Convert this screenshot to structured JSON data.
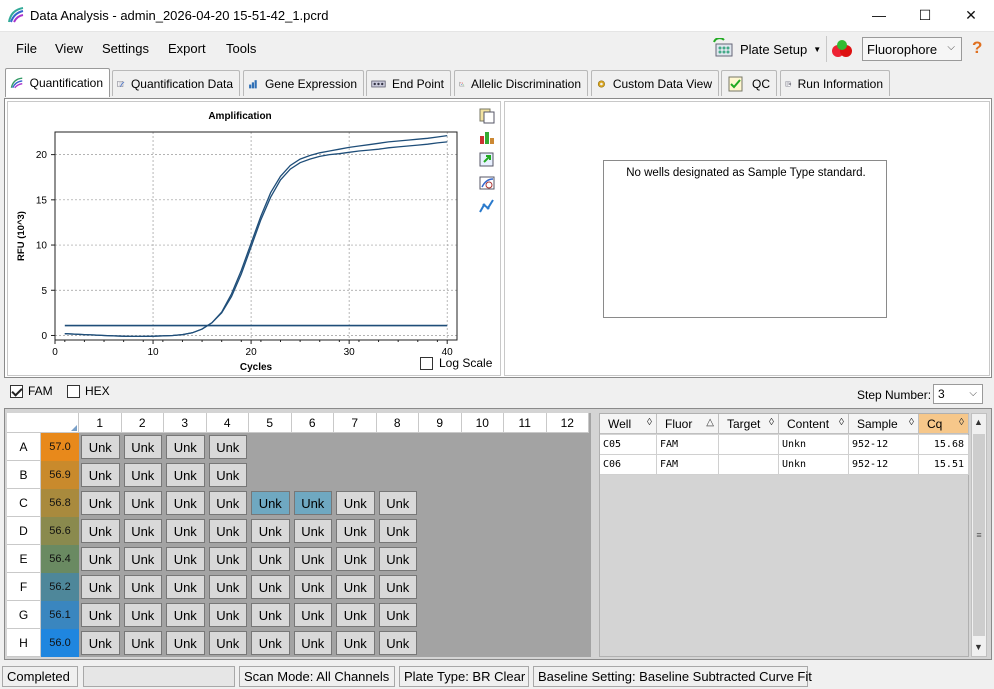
{
  "window": {
    "title": "Data Analysis - admin_2026-04-20 15-51-42_1.pcrd",
    "minimize_glyph": "—",
    "maximize_glyph": "☐",
    "close_glyph": "✕"
  },
  "menu": {
    "items": [
      "File",
      "View",
      "Settings",
      "Export",
      "Tools"
    ],
    "plate_setup": "Plate Setup",
    "fluorophore": "Fluorophore",
    "help_glyph": "?"
  },
  "tabs": [
    {
      "label": "Quantification",
      "active": true
    },
    {
      "label": "Quantification Data"
    },
    {
      "label": "Gene Expression"
    },
    {
      "label": "End Point"
    },
    {
      "label": "Allelic Discrimination"
    },
    {
      "label": "Custom Data View"
    },
    {
      "label": "QC"
    },
    {
      "label": "Run Information"
    }
  ],
  "chart_data": {
    "type": "line",
    "title": "Amplification",
    "xlabel": "Cycles",
    "ylabel": "RFU (10^3)",
    "xlim": [
      0,
      41
    ],
    "ylim": [
      -0.5,
      22.5
    ],
    "xticks": [
      0,
      10,
      20,
      30,
      40
    ],
    "yticks": [
      0,
      5,
      10,
      15,
      20
    ],
    "grid": true,
    "series": [
      {
        "x": [
          1,
          2,
          3,
          4,
          5,
          6,
          7,
          8,
          9,
          10,
          11,
          12,
          13,
          14,
          15,
          16,
          17,
          18,
          19,
          20,
          21,
          22,
          23,
          24,
          25,
          26,
          27,
          28,
          29,
          30,
          31,
          32,
          33,
          34,
          35,
          36,
          37,
          38,
          39,
          40
        ],
        "values": [
          0.2,
          0.15,
          0.1,
          0.05,
          0.0,
          -0.05,
          -0.08,
          -0.1,
          -0.1,
          -0.08,
          -0.05,
          0.0,
          0.1,
          0.3,
          0.7,
          1.4,
          2.6,
          4.6,
          7.2,
          10.2,
          13.2,
          15.8,
          17.6,
          18.8,
          19.5,
          19.9,
          20.2,
          20.4,
          20.6,
          20.8,
          20.95,
          21.1,
          21.25,
          21.4,
          21.5,
          21.6,
          21.7,
          21.8,
          21.95,
          22.1
        ]
      },
      {
        "x": [
          1,
          2,
          3,
          4,
          5,
          6,
          7,
          8,
          9,
          10,
          11,
          12,
          13,
          14,
          15,
          16,
          17,
          18,
          19,
          20,
          21,
          22,
          23,
          24,
          25,
          26,
          27,
          28,
          29,
          30,
          31,
          32,
          33,
          34,
          35,
          36,
          37,
          38,
          39,
          40
        ],
        "values": [
          0.2,
          0.15,
          0.1,
          0.05,
          0.0,
          -0.05,
          -0.08,
          -0.1,
          -0.1,
          -0.08,
          -0.05,
          0.0,
          0.1,
          0.3,
          0.7,
          1.4,
          2.5,
          4.3,
          6.8,
          9.8,
          12.8,
          15.3,
          17.2,
          18.4,
          19.1,
          19.5,
          19.8,
          20.0,
          20.1,
          20.25,
          20.4,
          20.5,
          20.6,
          20.75,
          20.85,
          20.95,
          21.05,
          21.15,
          21.3,
          21.4
        ]
      }
    ],
    "threshold": 1.1,
    "log_scale_label": "Log Scale"
  },
  "standard_pane": {
    "message": "No wells designated as Sample Type standard."
  },
  "fluor_bar": {
    "fam": "FAM",
    "hex": "HEX",
    "step_label": "Step Number:",
    "step_value": "3"
  },
  "plate": {
    "columns": [
      "1",
      "2",
      "3",
      "4",
      "5",
      "6",
      "7",
      "8",
      "9",
      "10",
      "11",
      "12"
    ],
    "rows": [
      {
        "label": "A",
        "temp": "57.0",
        "color": "#e8891b",
        "wells": [
          "Unk",
          "Unk",
          "Unk",
          "Unk",
          "",
          "",
          "",
          "",
          "",
          "",
          "",
          ""
        ]
      },
      {
        "label": "B",
        "temp": "56.9",
        "color": "#c98a2c",
        "wells": [
          "Unk",
          "Unk",
          "Unk",
          "Unk",
          "",
          "",
          "",
          "",
          "",
          "",
          "",
          ""
        ]
      },
      {
        "label": "C",
        "temp": "56.8",
        "color": "#a98a3d",
        "wells": [
          "Unk",
          "Unk",
          "Unk",
          "Unk",
          "Unk",
          "Unk",
          "Unk",
          "Unk",
          "",
          "",
          "",
          ""
        ],
        "selected": [
          4,
          5
        ]
      },
      {
        "label": "D",
        "temp": "56.6",
        "color": "#8a8a4e",
        "wells": [
          "Unk",
          "Unk",
          "Unk",
          "Unk",
          "Unk",
          "Unk",
          "Unk",
          "Unk",
          "",
          "",
          "",
          ""
        ]
      },
      {
        "label": "E",
        "temp": "56.4",
        "color": "#6a8a62",
        "wells": [
          "Unk",
          "Unk",
          "Unk",
          "Unk",
          "Unk",
          "Unk",
          "Unk",
          "Unk",
          "",
          "",
          "",
          ""
        ]
      },
      {
        "label": "F",
        "temp": "56.2",
        "color": "#4e879a",
        "wells": [
          "Unk",
          "Unk",
          "Unk",
          "Unk",
          "Unk",
          "Unk",
          "Unk",
          "Unk",
          "",
          "",
          "",
          ""
        ]
      },
      {
        "label": "G",
        "temp": "56.1",
        "color": "#3a86bf",
        "wells": [
          "Unk",
          "Unk",
          "Unk",
          "Unk",
          "Unk",
          "Unk",
          "Unk",
          "Unk",
          "",
          "",
          "",
          ""
        ]
      },
      {
        "label": "H",
        "temp": "56.0",
        "color": "#1f86df",
        "wells": [
          "Unk",
          "Unk",
          "Unk",
          "Unk",
          "Unk",
          "Unk",
          "Unk",
          "Unk",
          "",
          "",
          "",
          ""
        ]
      }
    ]
  },
  "results_table": {
    "headers": [
      "Well",
      "Fluor",
      "Target",
      "Content",
      "Sample",
      "Cq"
    ],
    "rows": [
      [
        "C05",
        "FAM",
        "",
        "Unkn",
        "952-12",
        "15.68"
      ],
      [
        "C06",
        "FAM",
        "",
        "Unkn",
        "952-12",
        "15.51"
      ]
    ]
  },
  "status": {
    "state": "Completed",
    "scan_mode": "Scan Mode: All Channels",
    "plate_type": "Plate Type: BR Clear",
    "baseline": "Baseline Setting: Baseline Subtracted Curve Fit"
  },
  "colors": {
    "accent": "#1f4e79",
    "selected_well": "#6fa8c1",
    "cq_header": "#f6c78a"
  }
}
